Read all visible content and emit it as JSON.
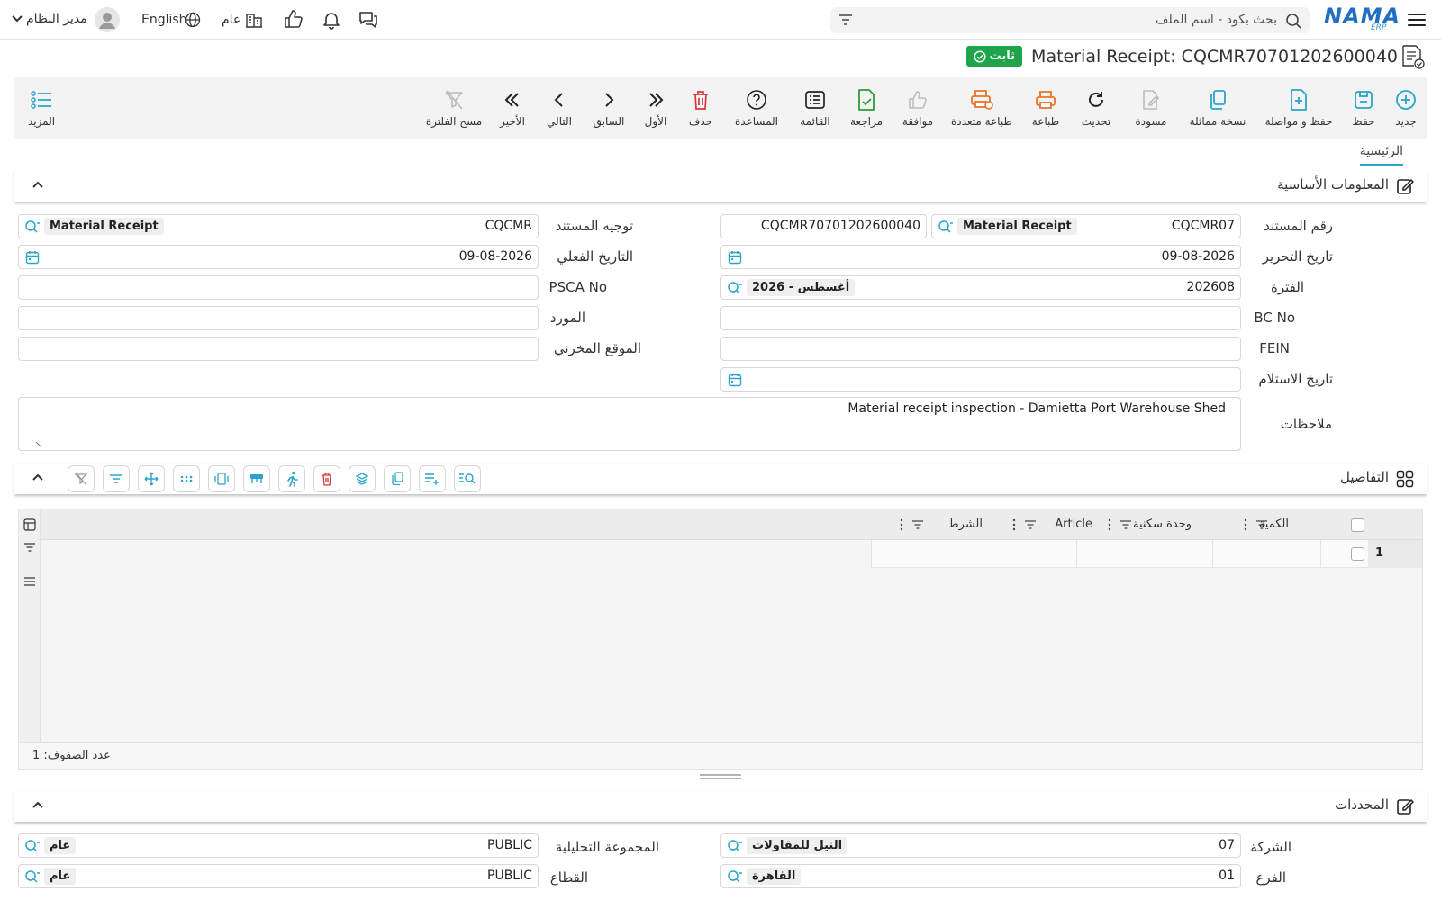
{
  "topbar": {
    "search_placeholder": "بحث بكود - اسم الملف",
    "logo": "NAMA",
    "logo_sub": "ERP",
    "user": "مدير النظام",
    "language": "English",
    "branch": "عام"
  },
  "document": {
    "title": "Material Receipt: CQCMR70701202600040",
    "status": "ثابت"
  },
  "toolbar": {
    "new": "جديد",
    "save": "حفظ",
    "save_continue": "حفظ و مواصلة",
    "duplicate": "نسخة مماثلة",
    "draft": "مسودة",
    "refresh": "تحديث",
    "print": "طباعة",
    "multi_print": "طباعة متعددة",
    "approve": "موافقة",
    "review": "مراجعة",
    "list": "القائمة",
    "help": "المساعدة",
    "delete": "حذف",
    "first": "الأول",
    "previous": "السابق",
    "next": "التالي",
    "last": "الأخير",
    "clear_filter": "مسح الفلترة",
    "more": "المزيد"
  },
  "tabs": {
    "main": "الرئيسية"
  },
  "basic_info": {
    "title": "المعلومات الأساسية",
    "doc_number_label": "رقم المستند",
    "doc_number_code": "CQCMR07",
    "doc_number_type": "Material Receipt",
    "doc_number_full": "CQCMR70701202600040",
    "doc_direction_label": "توجيه المستند",
    "doc_direction_code": "CQCMR",
    "doc_direction_type": "Material Receipt",
    "edit_date_label": "تاريخ التحرير",
    "edit_date": "09-08-2026",
    "actual_date_label": "التاريخ الفعلي",
    "actual_date": "09-08-2026",
    "period_label": "الفترة",
    "period_code": "202608",
    "period_name": "2026 - أغسطس",
    "psca_label": "PSCA No",
    "bc_label": "BC No",
    "supplier_label": "المورد",
    "fein_label": "FEIN",
    "warehouse_label": "الموقع المخزني",
    "receipt_date_label": "تاريخ الاستلام",
    "notes_label": "ملاحظات",
    "notes": "Material receipt inspection - Damietta Port Warehouse Shed"
  },
  "details": {
    "title": "التفاصيل",
    "columns": [
      "الكمية",
      "وحدة سكنية",
      "Article",
      "الشرط"
    ],
    "row_number": "1",
    "row_count": "عدد الصفوف: 1"
  },
  "dimensions": {
    "title": "المحددات",
    "company_label": "الشركة",
    "company_code": "07",
    "company_name": "النيل للمقاولات",
    "analytic_group_label": "المجموعة التحليلية",
    "analytic_group_code": "PUBLIC",
    "analytic_group_name": "عام",
    "branch_label": "الفرع",
    "branch_code": "01",
    "branch_name": "القاهرة",
    "sector_label": "القطاع",
    "sector_code": "PUBLIC",
    "sector_name": "عام"
  },
  "colors": {
    "accent": "#2aa5c9",
    "status_green": "#1fa34b",
    "danger": "#d93636",
    "print_orange": "#e8742a",
    "review_green": "#2f9b3a",
    "logo_blue": "#1f6fc2"
  }
}
